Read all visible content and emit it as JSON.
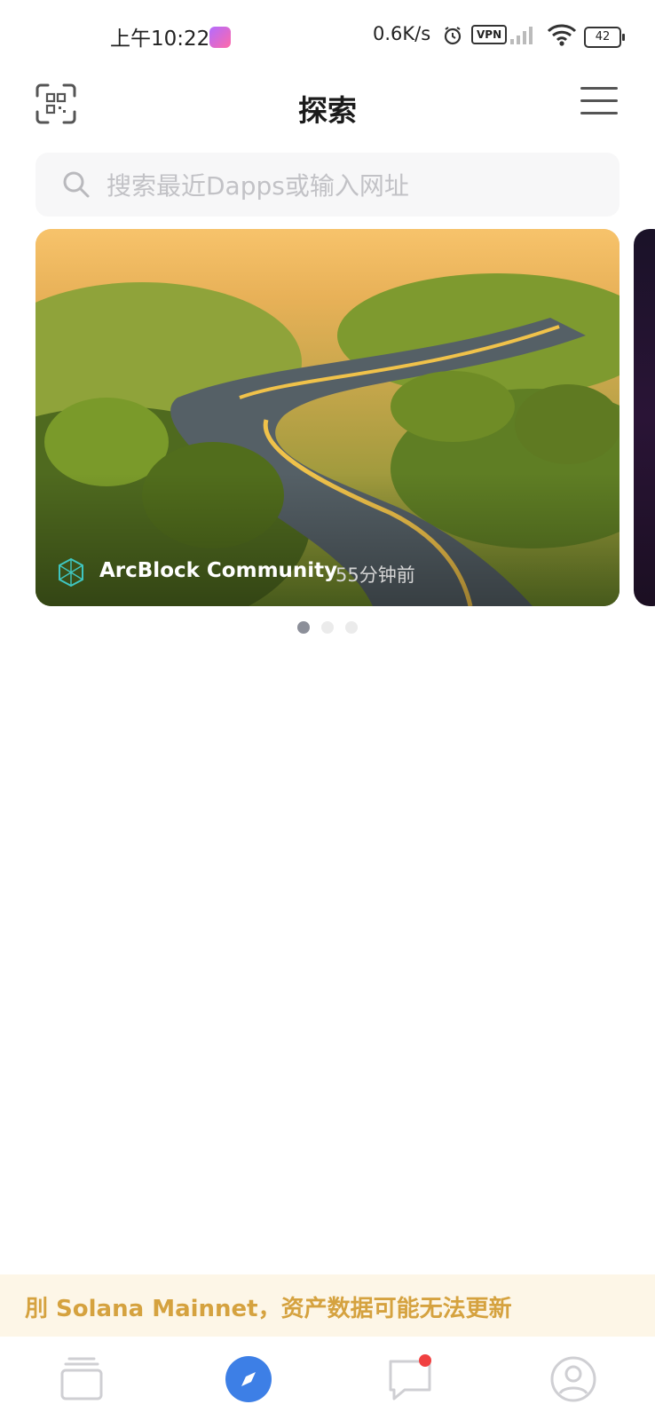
{
  "status_bar": {
    "time": "上午10:22",
    "network_speed": "0.6K/s",
    "vpn": "VPN",
    "battery": "42"
  },
  "header": {
    "title": "探索"
  },
  "search": {
    "placeholder": "搜索最近Dapps或输入网址",
    "value": ""
  },
  "banner": {
    "title": "ArcBlock Community",
    "time_ago": "55分钟前",
    "pages": 3,
    "active_page": 1
  },
  "notice": {
    "text": "刖 Solana Mainnet，资产数据可能无法更新"
  },
  "tabbar": {
    "items": [
      {
        "icon": "cards-icon",
        "active": false
      },
      {
        "icon": "compass-icon",
        "active": true
      },
      {
        "icon": "chat-icon",
        "active": false,
        "badge": true
      },
      {
        "icon": "profile-icon",
        "active": false
      }
    ]
  },
  "colors": {
    "accent": "#3d7fe6",
    "notice_text": "#d5a23f",
    "notice_bg": "#fdf6e7",
    "badge": "#f04040"
  }
}
